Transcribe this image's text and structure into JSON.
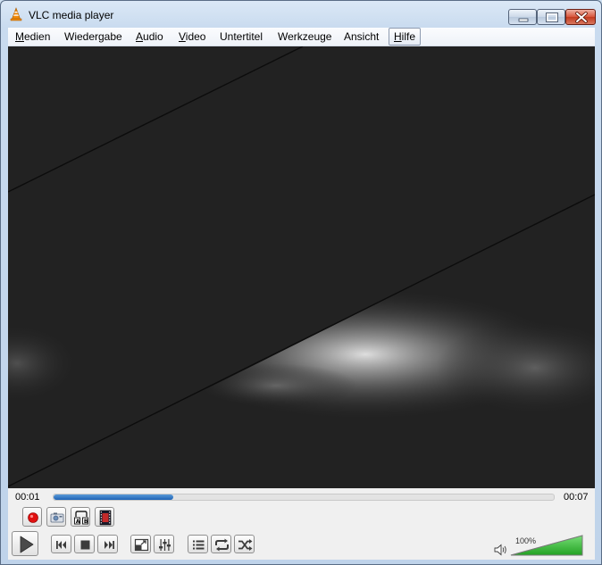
{
  "window": {
    "title": "VLC media player"
  },
  "menu": [
    {
      "id": "media",
      "label": "Medien",
      "accel": "M"
    },
    {
      "id": "playback",
      "label": "Wiedergabe",
      "accel": ""
    },
    {
      "id": "audio",
      "label": "Audio",
      "accel": "A"
    },
    {
      "id": "video",
      "label": "Video",
      "accel": "V"
    },
    {
      "id": "subtitle",
      "label": "Untertitel",
      "accel": ""
    },
    {
      "id": "tools",
      "label": "Werkzeuge",
      "accel": ""
    },
    {
      "id": "view",
      "label": "Ansicht",
      "accel": ""
    },
    {
      "id": "help",
      "label": "Hilfe",
      "accel": "H",
      "active": true
    }
  ],
  "playback": {
    "elapsed": "00:01",
    "duration": "00:07",
    "progress": 0.24
  },
  "volume": {
    "label": "100%",
    "level": 1.0
  },
  "colors": {
    "record": "#e01010",
    "progress": "#2a6fc0",
    "volume_fill": "#2fbf2f"
  },
  "icons": {
    "record": "record-icon",
    "snapshot": "snapshot-icon",
    "loop_ab": "loop-ab-icon",
    "frame_step": "frame-step-icon",
    "play": "play-icon",
    "previous": "previous-icon",
    "stop": "stop-icon",
    "next": "next-icon",
    "fullscreen": "fullscreen-icon",
    "extended": "extended-settings-icon",
    "playlist": "playlist-icon",
    "loop": "loop-icon",
    "random": "random-icon",
    "speaker": "speaker-icon"
  }
}
